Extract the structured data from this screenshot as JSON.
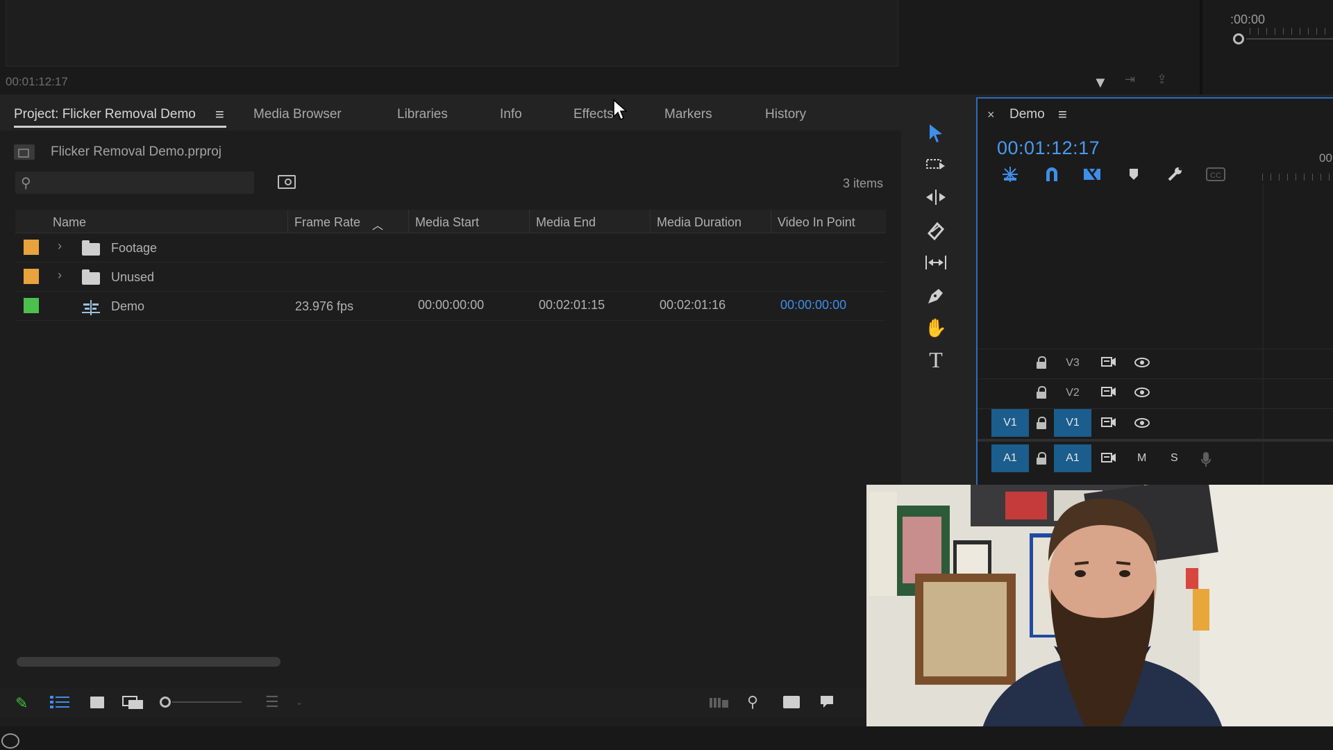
{
  "source_monitor": {
    "timecode": "00:01:12:17"
  },
  "program_monitor": {
    "timecode": ":00:00"
  },
  "tabs": {
    "project": "Project: Flicker Removal Demo",
    "media_browser": "Media Browser",
    "libraries": "Libraries",
    "info": "Info",
    "effects": "Effects",
    "markers": "Markers",
    "history": "History"
  },
  "project": {
    "filename": "Flicker Removal Demo.prproj",
    "search_value": "",
    "item_count": "3 items",
    "columns": [
      "Name",
      "Frame Rate",
      "Media Start",
      "Media End",
      "Media Duration",
      "Video In Point"
    ],
    "rows": [
      {
        "name": "Footage",
        "type": "bin",
        "label_color": "#e8a33c",
        "frame_rate": "",
        "media_start": "",
        "media_end": "",
        "media_duration": "",
        "video_in": ""
      },
      {
        "name": "Unused",
        "type": "bin",
        "label_color": "#e8a33c",
        "frame_rate": "",
        "media_start": "",
        "media_end": "",
        "media_duration": "",
        "video_in": ""
      },
      {
        "name": "Demo",
        "type": "sequence",
        "label_color": "#4cc04c",
        "frame_rate": "23.976 fps",
        "media_start": "00:00:00:00",
        "media_end": "00:02:01:15",
        "media_duration": "00:02:01:16",
        "video_in": "00:00:00:00"
      }
    ]
  },
  "timeline": {
    "sequence_name": "Demo",
    "timecode": "00:01:12:17",
    "ruler_label": "00",
    "tracks": [
      {
        "target": "V3",
        "source": "",
        "type": "video"
      },
      {
        "target": "V2",
        "source": "",
        "type": "video"
      },
      {
        "target": "V1",
        "source": "V1",
        "type": "video"
      },
      {
        "target": "A1",
        "source": "A1",
        "type": "audio",
        "mute": "M",
        "solo": "S"
      }
    ]
  },
  "colors": {
    "accent": "#4a9aef",
    "patch": "#1b5d8c",
    "panel_border": "#2d6bbf"
  }
}
